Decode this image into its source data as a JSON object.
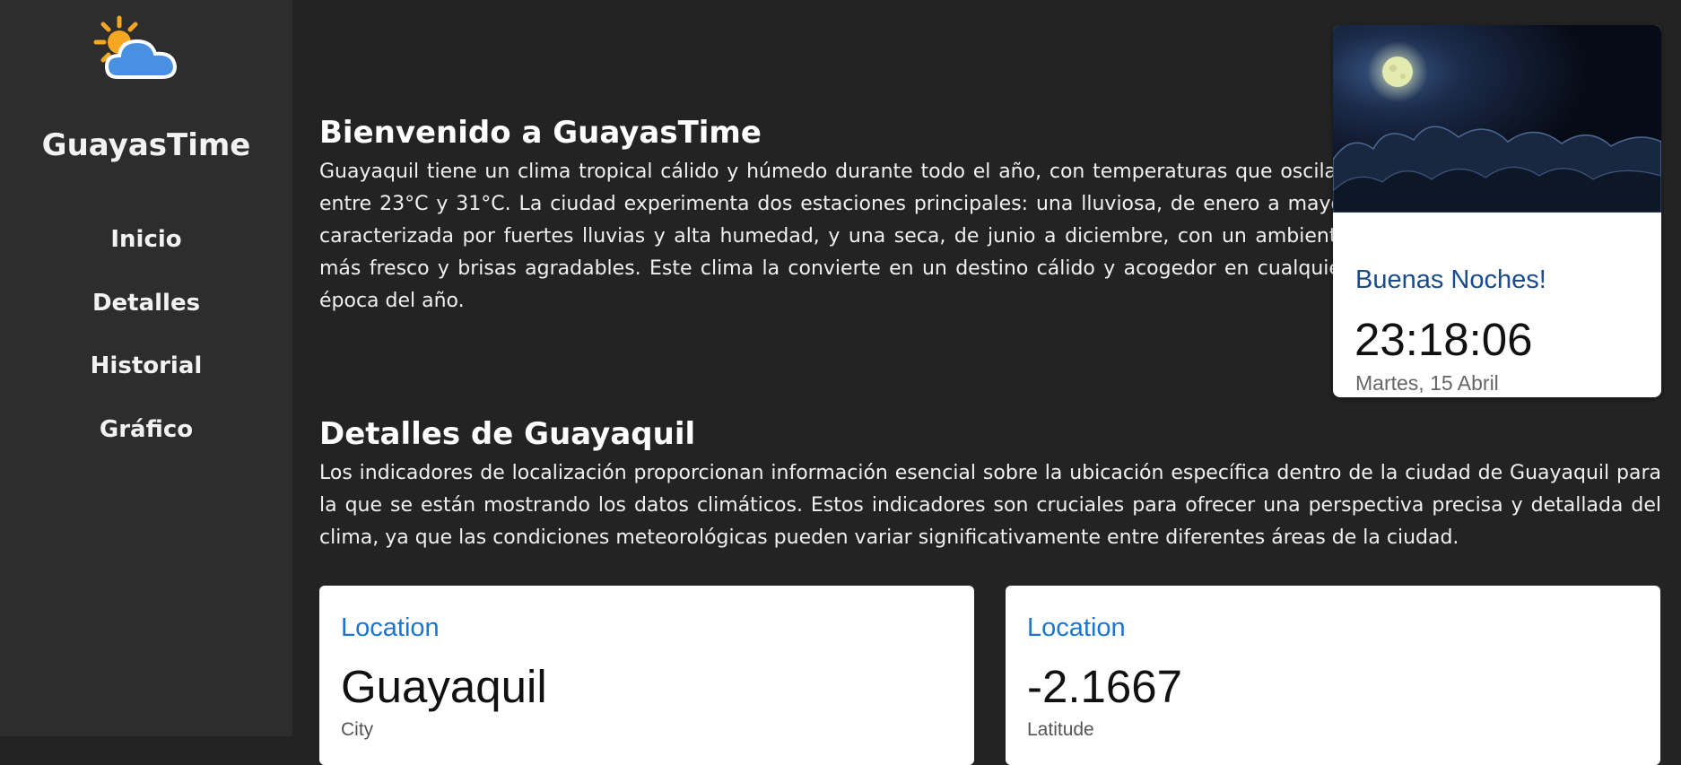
{
  "sidebar": {
    "logo_icon": "sun-cloud-icon",
    "app_name": "GuayasTime",
    "nav": [
      "Inicio",
      "Detalles",
      "Historial",
      "Gráfico"
    ]
  },
  "welcome": {
    "title": "Bienvenido a GuayasTime",
    "text": "Guayaquil tiene un clima tropical cálido y húmedo durante todo el año, con temperaturas que oscilan entre 23°C y 31°C. La ciudad experimenta dos estaciones principales: una lluviosa, de enero a mayo, caracterizada por fuertes lluvias y alta humedad, y una seca, de junio a diciembre, con un ambiente más fresco y brisas agradables. Este clima la convierte en un destino cálido y acogedor en cualquier época del año."
  },
  "clock": {
    "image": "night-sky-moon-clouds",
    "greeting": "Buenas Noches!",
    "time": "23:18:06",
    "date": "Martes, 15 Abril"
  },
  "details": {
    "title": "Detalles de Guayaquil",
    "text": "Los indicadores de localización proporcionan información esencial sobre la ubicación específica dentro de la ciudad de Guayaquil para la que se están mostrando los datos climáticos. Estos indicadores son cruciales para ofrecer una perspectiva precisa y detallada del clima, ya que las condiciones meteorológicas pueden variar significativamente entre diferentes áreas de la ciudad."
  },
  "cards": [
    {
      "label": "Location",
      "value": "Guayaquil",
      "sub": "City"
    },
    {
      "label": "Location",
      "value": "-2.1667",
      "sub": "Latitude"
    }
  ],
  "colors": {
    "background": "#232323",
    "sidebar": "#2d2d2d",
    "greeting": "#1a4b8c",
    "card_label": "#1976d2"
  }
}
